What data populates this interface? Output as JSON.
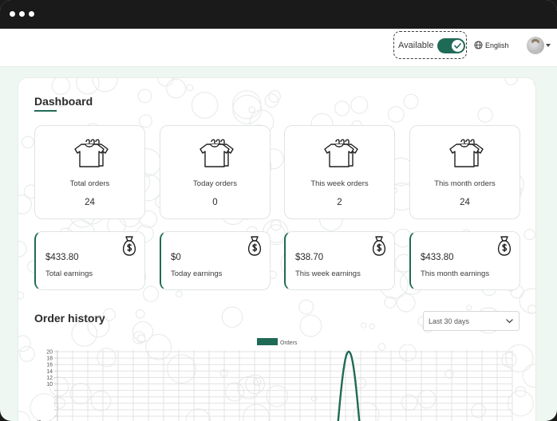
{
  "topbar": {
    "availability_label": "Available",
    "availability_on": true,
    "language": "English"
  },
  "dashboard": {
    "title": "Dashboard",
    "stats": [
      {
        "label": "Total orders",
        "value": "24"
      },
      {
        "label": "Today orders",
        "value": "0"
      },
      {
        "label": "This week orders",
        "value": "2"
      },
      {
        "label": "This month orders",
        "value": "24"
      }
    ],
    "earnings": [
      {
        "amount": "$433.80",
        "label": "Total earnings"
      },
      {
        "amount": "$0",
        "label": "Today earnings"
      },
      {
        "amount": "$38.70",
        "label": "This week earnings"
      },
      {
        "amount": "$433.80",
        "label": "This month earnings"
      }
    ],
    "order_history": {
      "title": "Order history",
      "range_selected": "Last 30 days"
    }
  },
  "colors": {
    "accent": "#1f6a56",
    "titlebar": "#1a1a1a",
    "background": "#eef7f1"
  },
  "chart_data": {
    "type": "line",
    "legend": [
      "Orders"
    ],
    "ylabel": "Orders",
    "y_ticks_visible": [
      20,
      18,
      16,
      14,
      12,
      10
    ],
    "ylim": [
      0,
      20
    ],
    "grid": true,
    "legend_position": "top",
    "series": [
      {
        "name": "Orders",
        "peak_value": 20
      }
    ]
  }
}
